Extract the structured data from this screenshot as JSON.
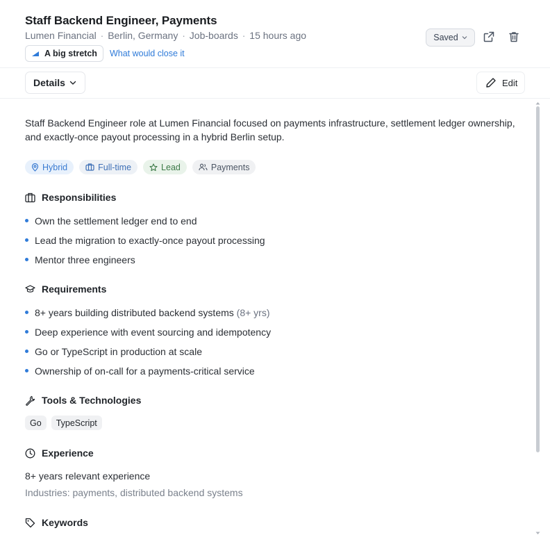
{
  "header": {
    "title": "Staff Backend Engineer, Payments",
    "company": "Lumen Financial",
    "location": "Berlin, Germany",
    "source": "Job-boards",
    "posted": "15 hours ago",
    "separator": "·",
    "fit_badge": "A big stretch",
    "fit_link": "What would close it",
    "saved_label": "Saved"
  },
  "subbar": {
    "details_label": "Details",
    "edit_label": "Edit"
  },
  "summary": "Staff Backend Engineer role at Lumen Financial focused on payments infrastructure, settlement ledger ownership, and exactly-once payout processing in a hybrid Berlin setup.",
  "tags": [
    {
      "label": "Hybrid",
      "icon": "location-pin-icon",
      "color": "#3a7bd1"
    },
    {
      "label": "Full-time",
      "icon": "briefcase-icon",
      "color": "#3d6fb6"
    },
    {
      "label": "Lead",
      "icon": "star-icon",
      "color": "#3c7a47"
    },
    {
      "label": "Payments",
      "icon": "users-icon",
      "color": "#4b5563"
    }
  ],
  "responsibilities": {
    "heading": "Responsibilities",
    "items": [
      "Own the settlement ledger end to end",
      "Lead the migration to exactly-once payout processing",
      "Mentor three engineers"
    ]
  },
  "requirements": {
    "heading": "Requirements",
    "items": [
      {
        "text": "8+ years building distributed backend systems",
        "note": "(8+ yrs)"
      },
      {
        "text": "Deep experience with event sourcing and idempotency",
        "note": ""
      },
      {
        "text": "Go or TypeScript in production at scale",
        "note": ""
      },
      {
        "text": "Ownership of on-call for a payments-critical service",
        "note": ""
      }
    ]
  },
  "tools": {
    "heading": "Tools & Technologies",
    "items": [
      "Go",
      "TypeScript"
    ]
  },
  "experience": {
    "heading": "Experience",
    "years": "8+ years relevant experience",
    "industries": "Industries: payments, distributed backend systems"
  },
  "keywords": {
    "heading": "Keywords"
  },
  "colors": {
    "accent": "#2f7bd9",
    "bullet": "#2f7bd9"
  }
}
